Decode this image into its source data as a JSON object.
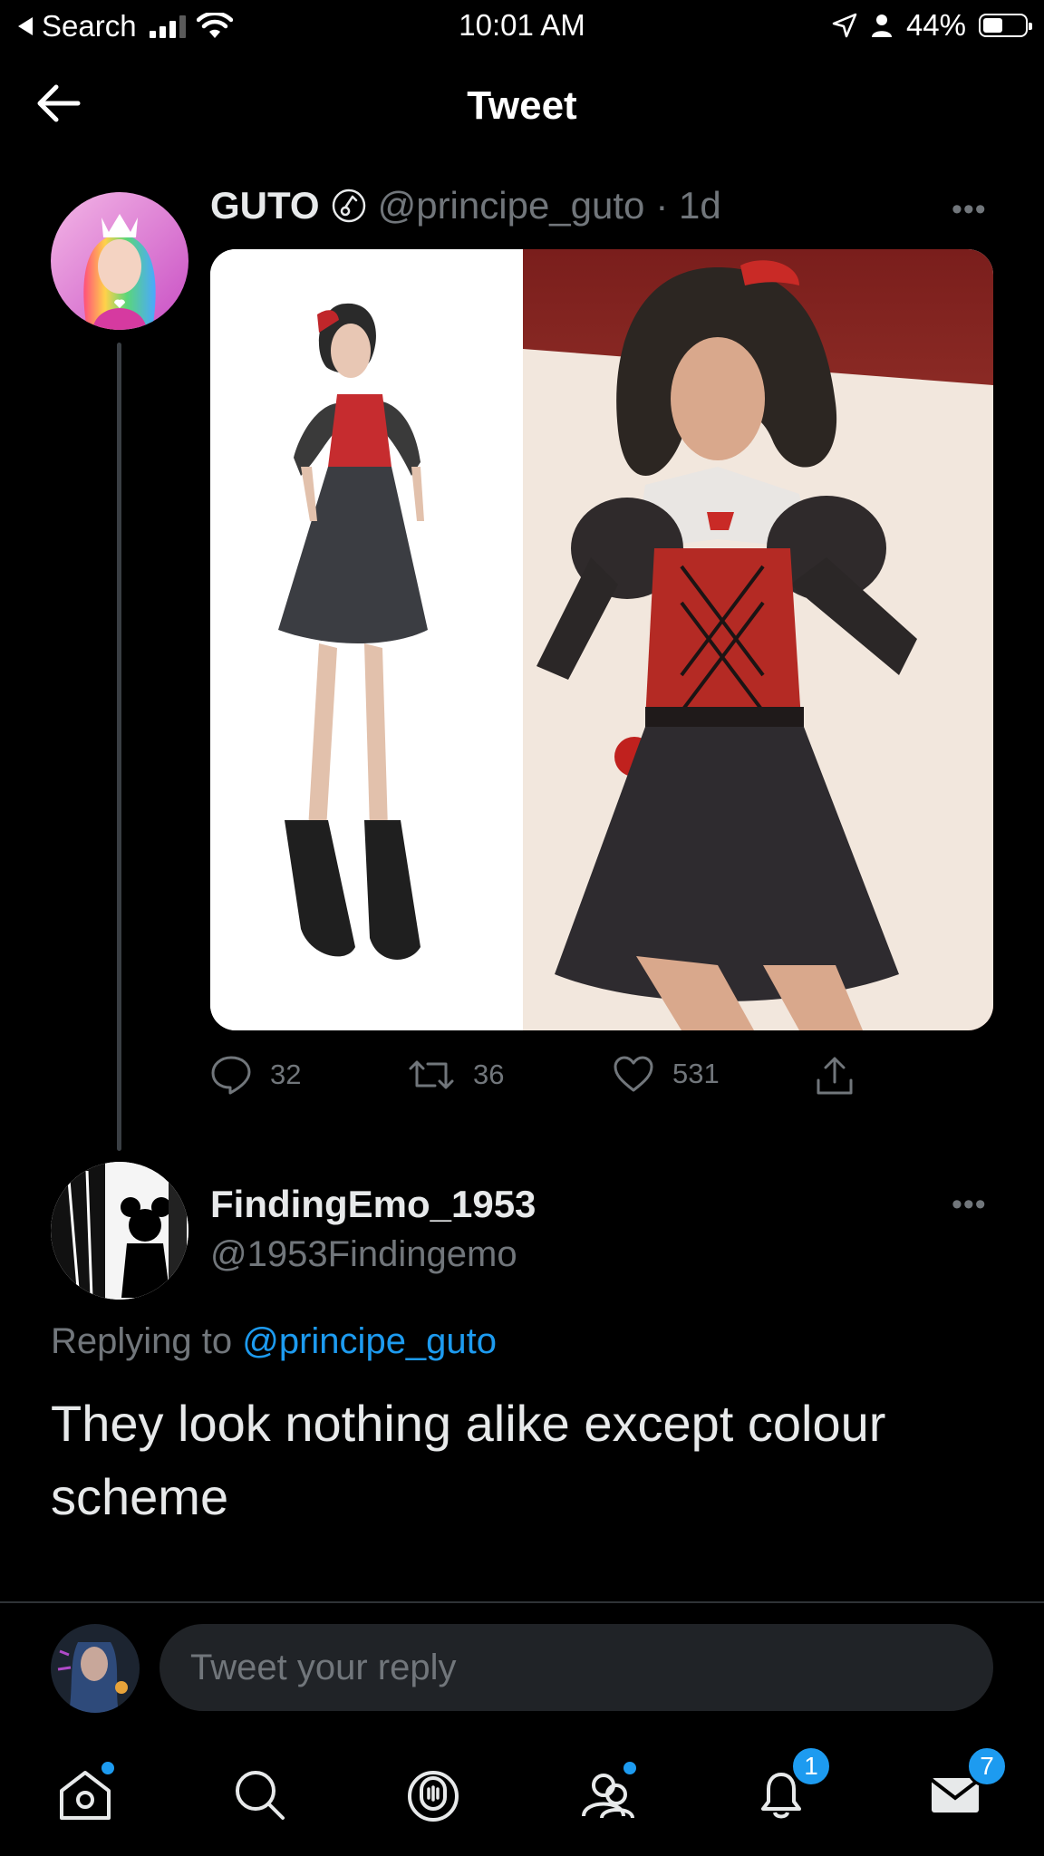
{
  "status_bar": {
    "back_app": "Search",
    "time": "10:01 AM",
    "battery": "44%"
  },
  "header": {
    "title": "Tweet"
  },
  "tweet": {
    "display_name": "GUTO",
    "handle": "@principe_guto",
    "time_ago": "· 1d",
    "replies": "32",
    "retweets": "36",
    "likes": "531"
  },
  "reply": {
    "display_name": "FindingEmo_1953",
    "handle": "@1953Findingemo",
    "replying_prefix": "Replying to",
    "replying_handle": "@principe_guto",
    "text": "They look nothing alike except colour scheme"
  },
  "composer": {
    "placeholder": "Tweet your reply"
  },
  "tab_bar": {
    "notifications_badge": "1",
    "messages_badge": "7"
  },
  "colors": {
    "accent": "#1d9bf0",
    "muted": "#71767b",
    "background": "#000000"
  }
}
